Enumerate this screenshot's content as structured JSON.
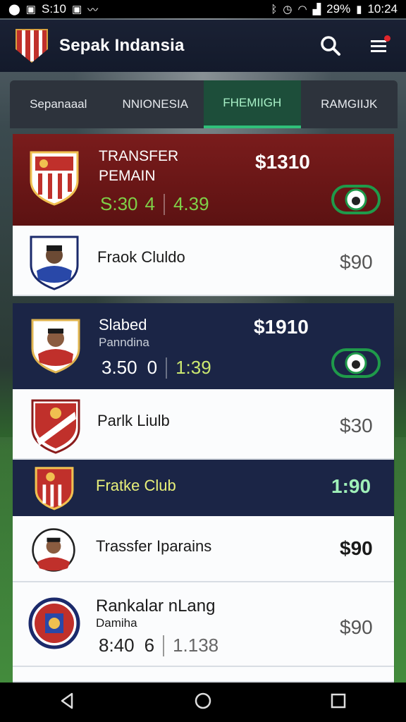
{
  "status": {
    "left_text": "S:10",
    "battery": "29%",
    "time": "10:24"
  },
  "app": {
    "title": "Sepak Indansia",
    "search_icon": "search-icon",
    "menu_icon": "menu-icon"
  },
  "tabs": [
    {
      "label": "Sepanaaal",
      "active": false
    },
    {
      "label": "NNIONESIA",
      "active": false
    },
    {
      "label": "FHEMIIGH",
      "active": true
    },
    {
      "label": "RAMGIIJK",
      "active": false
    }
  ],
  "rows": [
    {
      "name": "TRANSFER",
      "sub": "PEMAIN",
      "price": "$1310",
      "stat_a": "S:30",
      "stat_b": "4",
      "stat_c": "4.39"
    },
    {
      "name": "Fraok Cluldo",
      "price": "$90"
    },
    {
      "name": "Slabed",
      "sub": "Panndina",
      "price": "$1910",
      "stat_a": "3.50",
      "stat_b": "0",
      "stat_c": "1:39"
    },
    {
      "name": "Parlk Liulb",
      "price": "$30"
    },
    {
      "name": "Fratke Club",
      "price": "1:90"
    },
    {
      "name": "Trassfer Iparains",
      "price": "$90"
    },
    {
      "name": "Rankalar nLang",
      "sub": "Damiha",
      "price": "$90",
      "stat_a": "8:40",
      "stat_b": "6",
      "stat_c": "1.138"
    }
  ],
  "colors": {
    "accent": "#30c07a",
    "header": "#131a2b",
    "red_row": "#7a1c1c",
    "navy_row": "#1b2546"
  }
}
